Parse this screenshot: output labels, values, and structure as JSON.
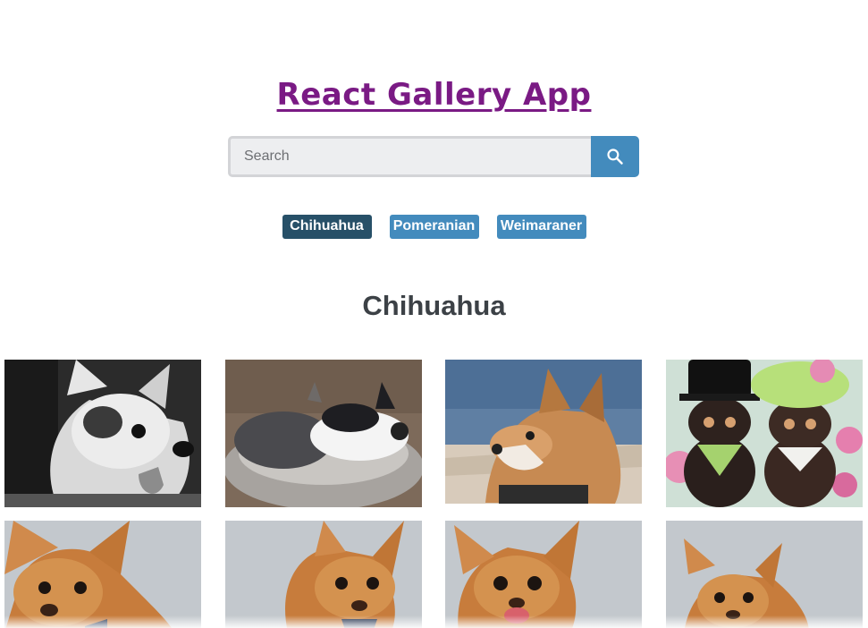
{
  "header": {
    "title": "React Gallery App"
  },
  "search": {
    "placeholder": "Search",
    "value": ""
  },
  "nav": {
    "items": [
      {
        "label": "Chihuahua",
        "active": true
      },
      {
        "label": "Pomeranian",
        "active": false
      },
      {
        "label": "Weimaraner",
        "active": false
      }
    ]
  },
  "results": {
    "title": "Chihuahua",
    "photos": [
      {
        "icon": "bw-chihuahua-tongue-photo"
      },
      {
        "icon": "dogs-sleeping-in-bed-photo"
      },
      {
        "icon": "chihuahua-profile-beach-photo"
      },
      {
        "icon": "two-dogs-in-hats-photo"
      },
      {
        "icon": "chihuahua-bowtie-photo"
      },
      {
        "icon": "chihuahua-bowtie-photo"
      },
      {
        "icon": "chihuahua-licking-photo"
      },
      {
        "icon": "chihuahua-portrait-photo"
      }
    ]
  },
  "colors": {
    "title": "#7a1a84",
    "accent": "#438bbd",
    "active_nav": "#275068",
    "heading": "#3c4146"
  }
}
